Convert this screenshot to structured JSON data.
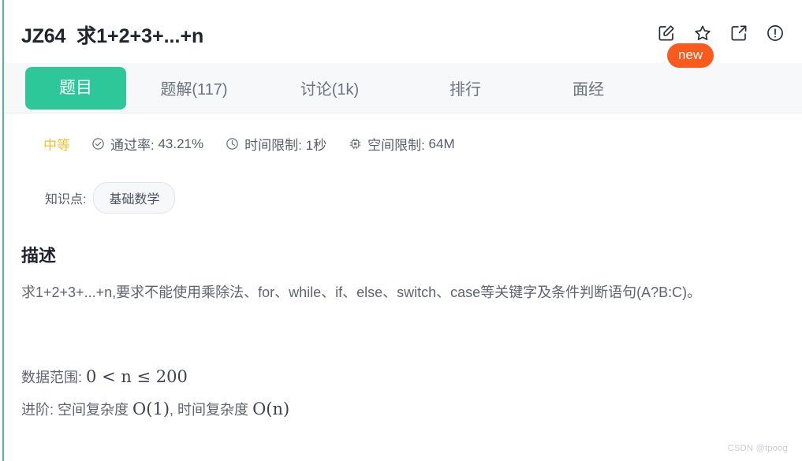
{
  "header": {
    "problem_id": "JZ64",
    "problem_name": "求1+2+3+...+n",
    "actions": [
      {
        "name": "edit-note-icon",
        "label": "笔记"
      },
      {
        "name": "star-icon",
        "label": "收藏"
      },
      {
        "name": "share-icon",
        "label": "分享"
      },
      {
        "name": "report-icon",
        "label": "反馈"
      }
    ]
  },
  "tabs": {
    "items": [
      {
        "label": "题目",
        "active": true
      },
      {
        "label": "题解(117)",
        "active": false
      },
      {
        "label": "讨论(1k)",
        "active": false
      },
      {
        "label": "排行",
        "active": false
      },
      {
        "label": "面经",
        "active": false
      }
    ],
    "badge": "new"
  },
  "meta": {
    "difficulty": "中等",
    "pass_rate_label": "通过率:",
    "pass_rate_value": "43.21%",
    "time_limit_label": "时间限制:",
    "time_limit_value": "1秒",
    "space_limit_label": "空间限制:",
    "space_limit_value": "64M"
  },
  "knowledge": {
    "label": "知识点:",
    "tags": [
      "基础数学"
    ]
  },
  "description": {
    "heading": "描述",
    "paragraph": "求1+2+3+...+n,要求不能使用乘除法、for、while、if、else、switch、case等关键字及条件判断语句(A?B:C)。",
    "range_label": "数据范围:",
    "range_value": "0 < n ≤ 200",
    "advanced_label": "进阶:",
    "advanced_space_label": "空间复杂度",
    "advanced_space_value": "O(1)",
    "advanced_sep": ",",
    "advanced_time_label": "时间复杂度",
    "advanced_time_value": "O(n)"
  },
  "watermark": "CSDN @tpoog",
  "colors": {
    "accent_green": "#2ec79a",
    "badge_orange": "#fb5a1e",
    "difficulty_yellow": "#f2c230",
    "tabbar_bg": "#f7f8fa",
    "left_rail": "#4cb3bd"
  }
}
